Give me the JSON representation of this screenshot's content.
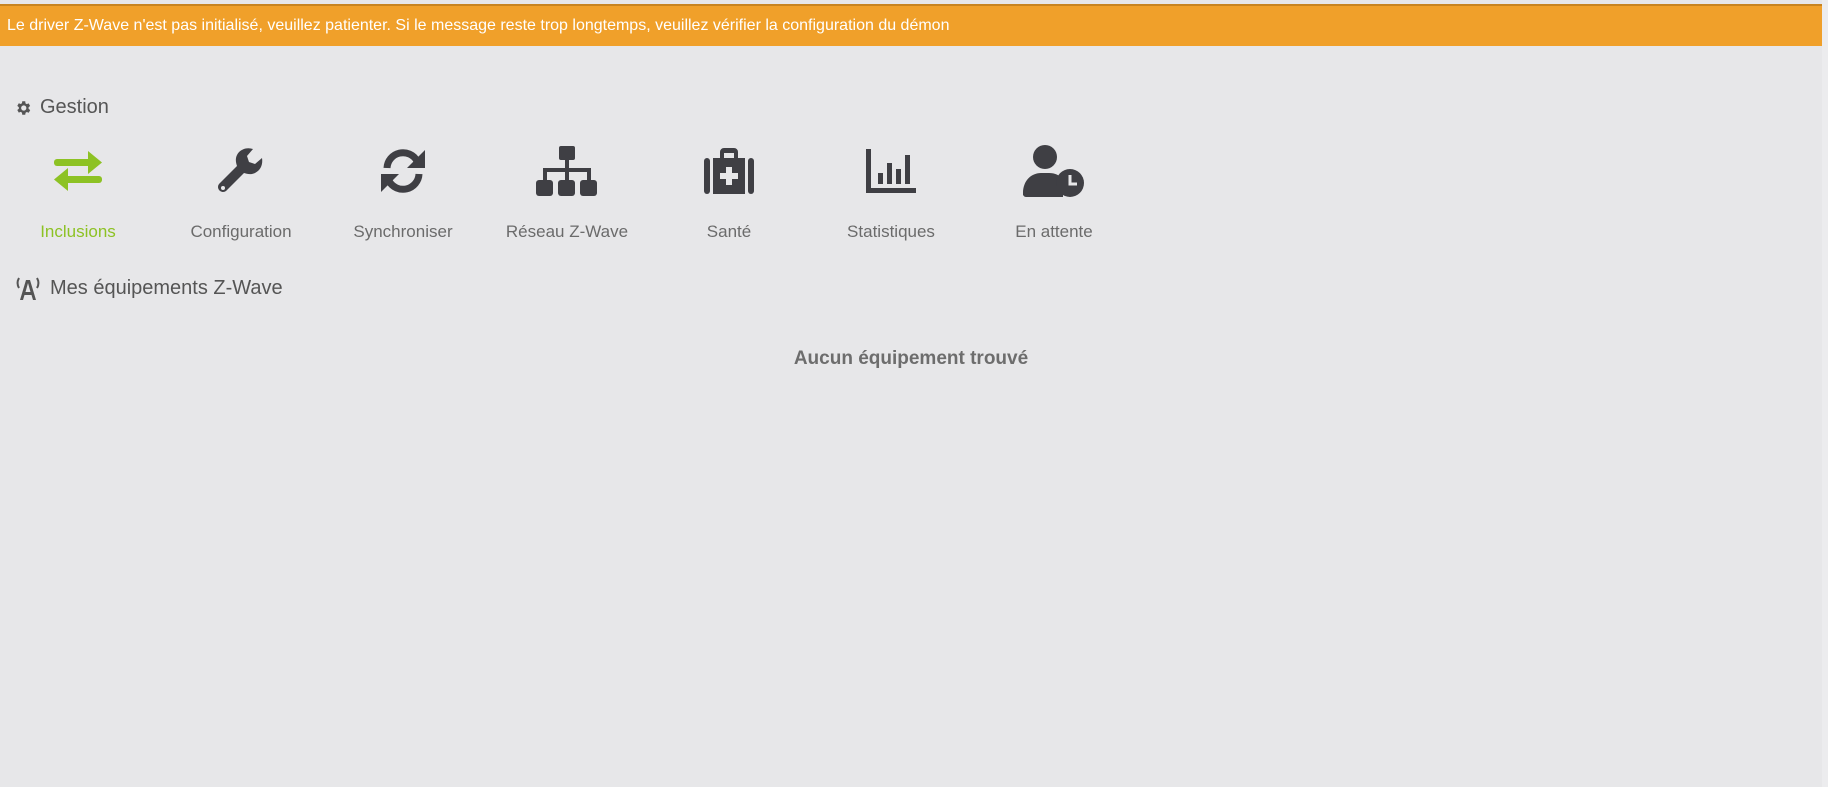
{
  "banner": {
    "message": "Le driver Z-Wave n'est pas initialisé, veuillez patienter. Si le message reste trop longtemps, veuillez vérifier la configuration du démon",
    "color": "#f0a02a"
  },
  "gestion": {
    "title": "Gestion",
    "items": [
      {
        "label": "Inclusions",
        "icon": "exchange-icon",
        "active": true
      },
      {
        "label": "Configuration",
        "icon": "wrench-icon"
      },
      {
        "label": "Synchroniser",
        "icon": "refresh-icon"
      },
      {
        "label": "Réseau Z-Wave",
        "icon": "sitemap-icon"
      },
      {
        "label": "Santé",
        "icon": "medkit-icon"
      },
      {
        "label": "Statistiques",
        "icon": "bar-chart-icon"
      },
      {
        "label": "En attente",
        "icon": "user-clock-icon"
      }
    ]
  },
  "devices": {
    "title": "Mes équipements Z-Wave",
    "empty_message": "Aucun équipement trouvé"
  },
  "colors": {
    "accent": "#8dc224",
    "icon": "#3f3f44"
  }
}
